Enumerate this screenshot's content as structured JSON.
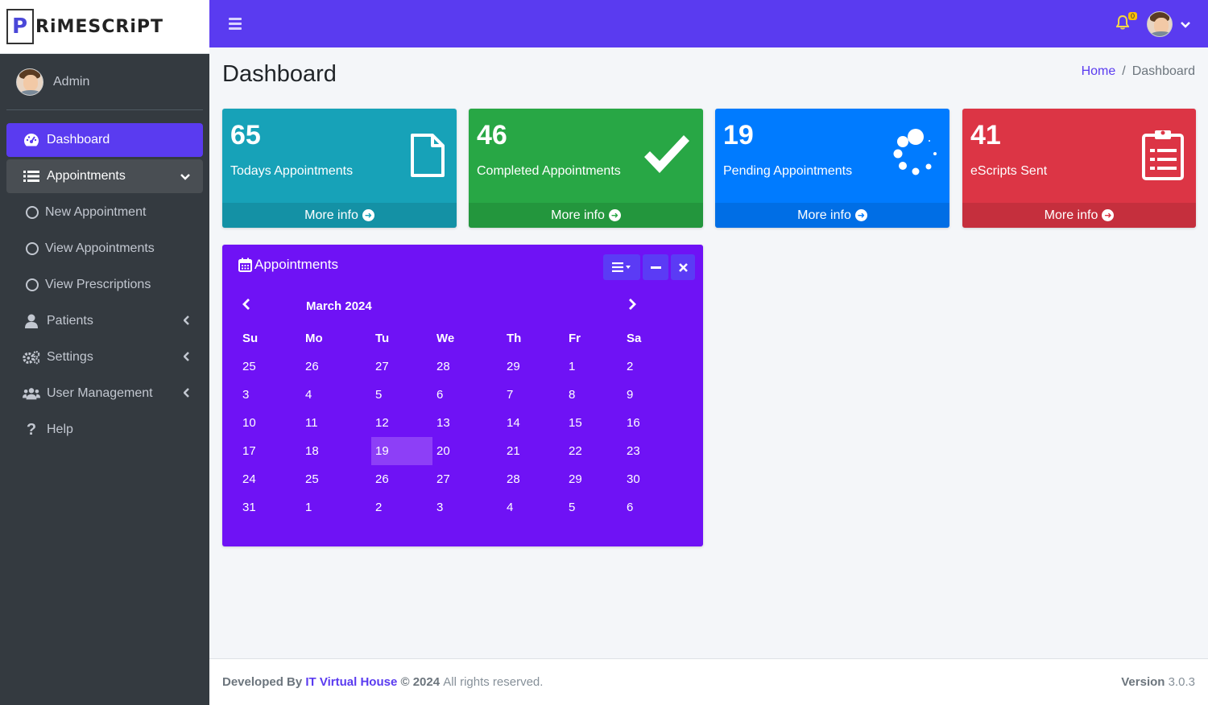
{
  "brand": {
    "logo_letter": "P",
    "logo_text": "RiMESCRiPT"
  },
  "user": {
    "name": "Admin"
  },
  "sidebar": {
    "items": [
      {
        "label": "Dashboard",
        "icon": "tachometer-icon"
      },
      {
        "label": "Appointments",
        "icon": "list-icon"
      },
      {
        "label": "New Appointment",
        "icon": "circle-icon"
      },
      {
        "label": "View Appointments",
        "icon": "circle-icon"
      },
      {
        "label": "View Prescriptions",
        "icon": "circle-icon"
      },
      {
        "label": "Patients",
        "icon": "user-icon"
      },
      {
        "label": "Settings",
        "icon": "cogs-icon"
      },
      {
        "label": "User Management",
        "icon": "users-icon"
      },
      {
        "label": "Help",
        "icon": "question-icon"
      }
    ]
  },
  "topbar": {
    "notification_count": "0"
  },
  "page": {
    "title": "Dashboard"
  },
  "breadcrumb": {
    "home": "Home",
    "separator": "/",
    "current": "Dashboard"
  },
  "stats": [
    {
      "value": "65",
      "label": "Todays Appointments",
      "more": "More info",
      "color": "#17a2b8",
      "icon": "file-icon"
    },
    {
      "value": "46",
      "label": "Completed Appointments",
      "more": "More info",
      "color": "#28a745",
      "icon": "check-icon"
    },
    {
      "value": "19",
      "label": "Pending Appointments",
      "more": "More info",
      "color": "#007bff",
      "icon": "spinner-icon"
    },
    {
      "value": "41",
      "label": "eScripts Sent",
      "more": "More info",
      "color": "#dc3545",
      "icon": "clipboard-icon"
    }
  ],
  "calendar": {
    "title": "Appointments",
    "month": "March 2024",
    "weekdays": [
      "Su",
      "Mo",
      "Tu",
      "We",
      "Th",
      "Fr",
      "Sa"
    ],
    "weeks": [
      [
        "25",
        "26",
        "27",
        "28",
        "29",
        "1",
        "2"
      ],
      [
        "3",
        "4",
        "5",
        "6",
        "7",
        "8",
        "9"
      ],
      [
        "10",
        "11",
        "12",
        "13",
        "14",
        "15",
        "16"
      ],
      [
        "17",
        "18",
        "19",
        "20",
        "21",
        "22",
        "23"
      ],
      [
        "24",
        "25",
        "26",
        "27",
        "28",
        "29",
        "30"
      ],
      [
        "31",
        "1",
        "2",
        "3",
        "4",
        "5",
        "6"
      ]
    ],
    "today": "19"
  },
  "footer": {
    "developed_by": "Developed By",
    "company": "IT Virtual House",
    "year": "© 2024",
    "rights": "All rights reserved.",
    "version_label": "Version",
    "version": "3.0.3"
  },
  "colors": {
    "accent": "#5a3bf0",
    "sidebar": "#343a40",
    "calendar": "#6f12f5"
  }
}
